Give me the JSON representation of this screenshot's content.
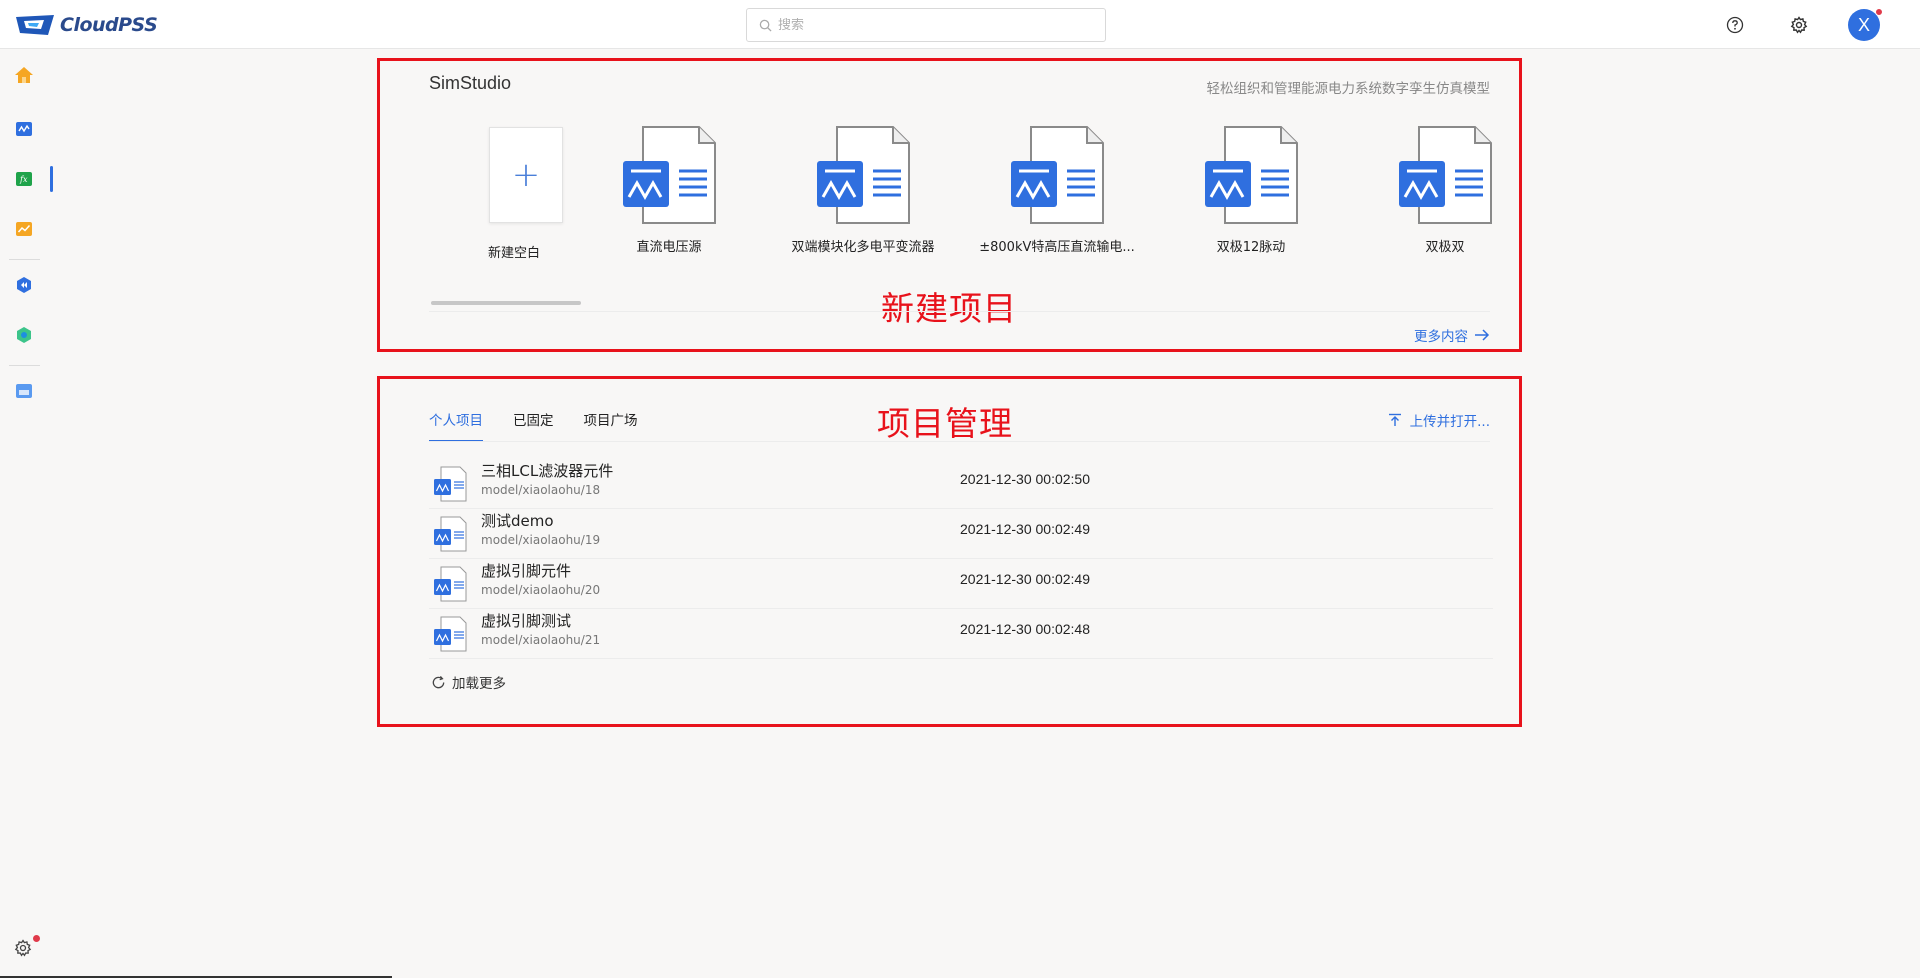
{
  "app": {
    "logo_text": "CloudPSS"
  },
  "header": {
    "search_placeholder": "搜索",
    "icons": [
      "help-icon",
      "settings-icon"
    ],
    "avatar_letter": "X"
  },
  "sidebar": {
    "items": [
      "home-icon",
      "simstudio-icon",
      "function-studio-icon",
      "chart-app-icon",
      "component-icon",
      "hexagon-app-icon",
      "file-icon"
    ],
    "bottom_icon": "settings-icon"
  },
  "simstudio": {
    "title": "SimStudio",
    "subtitle": "轻松组织和管理能源电力系统数字孪生仿真模型",
    "new_blank_label": "新建空白",
    "templates": [
      {
        "label": "直流电压源"
      },
      {
        "label": "双端模块化多电平变流器"
      },
      {
        "label": "±800kV特高压直流输电..."
      },
      {
        "label": "双极12脉动"
      },
      {
        "label": "双极双"
      }
    ],
    "more_label": "更多内容",
    "annotation": "新建项目"
  },
  "projects": {
    "annotation": "项目管理",
    "tabs": [
      {
        "label": "个人项目",
        "active": true
      },
      {
        "label": "已固定",
        "active": false
      },
      {
        "label": "项目广场",
        "active": false
      }
    ],
    "upload_label": "上传并打开...",
    "rows": [
      {
        "name": "三相LCL滤波器元件",
        "path": "model/xiaolaohu/18",
        "time": "2021-12-30 00:02:50"
      },
      {
        "name": "测试demo",
        "path": "model/xiaolaohu/19",
        "time": "2021-12-30 00:02:49"
      },
      {
        "name": "虚拟引脚元件",
        "path": "model/xiaolaohu/20",
        "time": "2021-12-30 00:02:49"
      },
      {
        "name": "虚拟引脚测试",
        "path": "model/xiaolaohu/21",
        "time": "2021-12-30 00:02:48"
      }
    ],
    "load_more_label": "加载更多"
  },
  "colors": {
    "accent": "#2f6fdf",
    "annotation_red": "#e8121b",
    "notification": "#e03a4a"
  }
}
